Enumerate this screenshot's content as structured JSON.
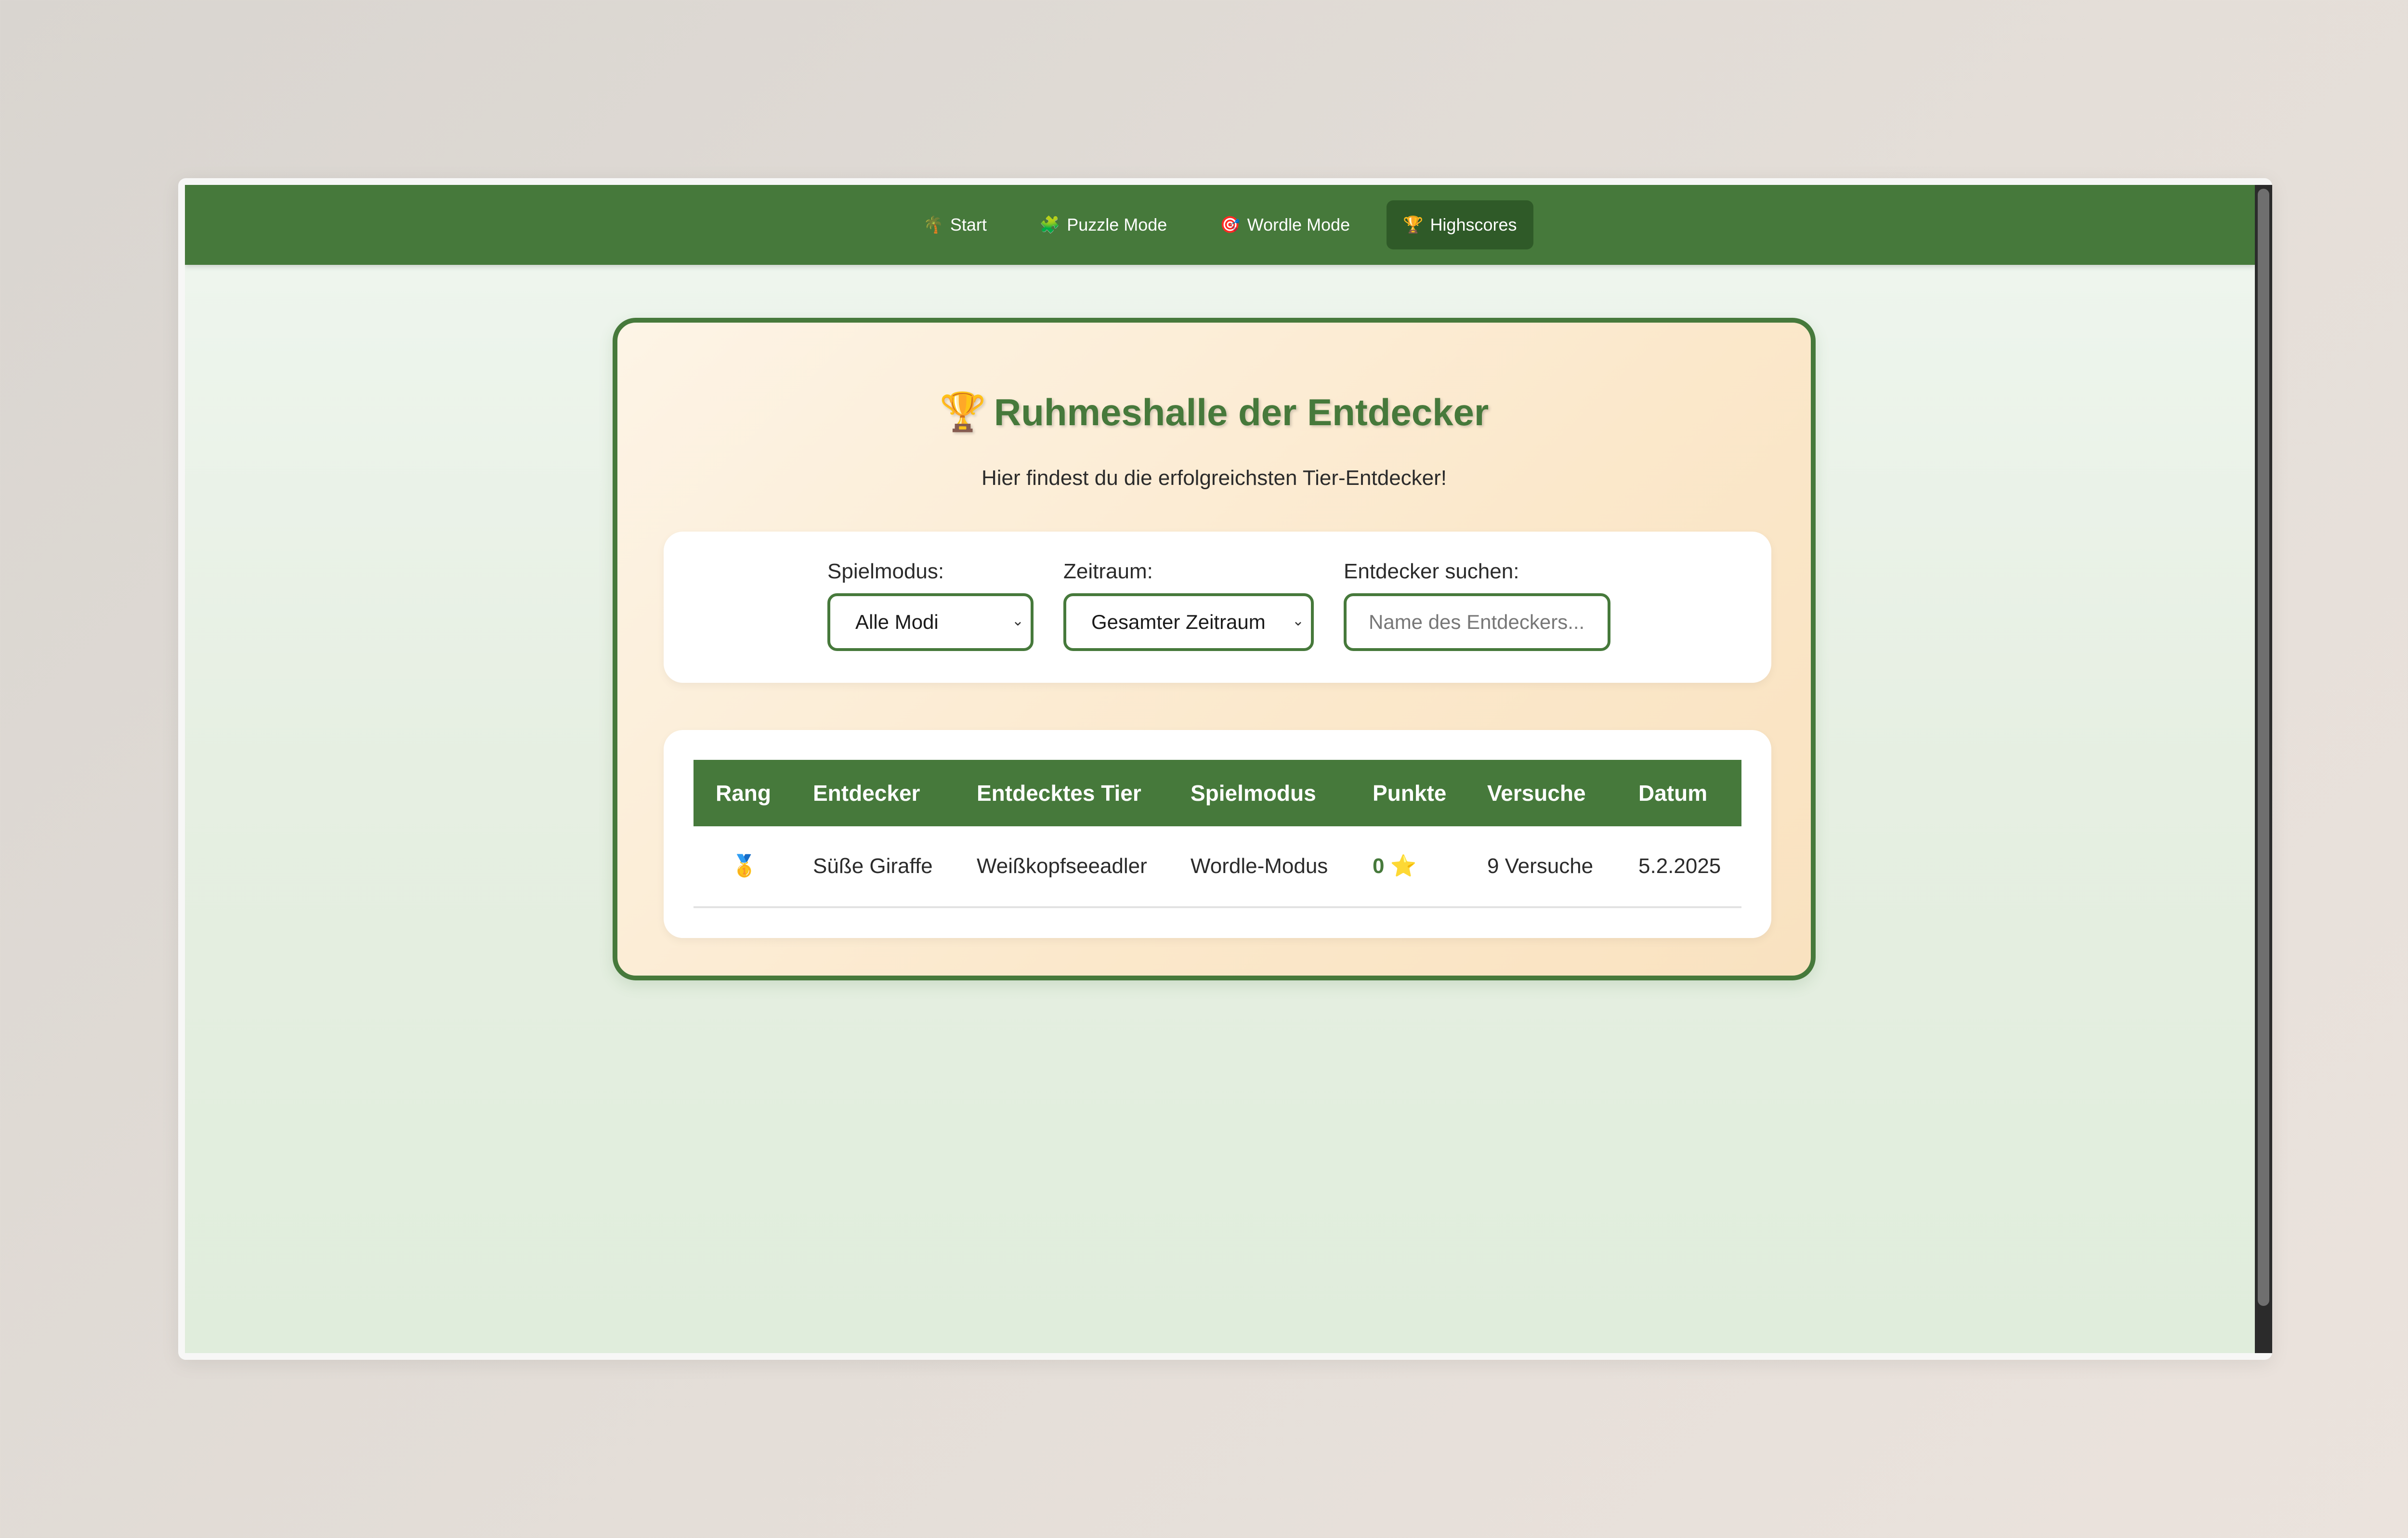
{
  "nav": {
    "items": [
      {
        "icon": "🌴",
        "label": "Start",
        "active": false
      },
      {
        "icon": "🧩",
        "label": "Puzzle Mode",
        "active": false
      },
      {
        "icon": "🎯",
        "label": "Wordle Mode",
        "active": false
      },
      {
        "icon": "🏆",
        "label": "Highscores",
        "active": true
      }
    ]
  },
  "page": {
    "title_icon": "🏆",
    "title": "Ruhmeshalle der Entdecker",
    "subtitle": "Hier findest du die erfolgreichsten Tier-Entdecker!"
  },
  "filters": {
    "mode_label": "Spielmodus:",
    "mode_value": "Alle Modi",
    "period_label": "Zeitraum:",
    "period_value": "Gesamter Zeitraum",
    "search_label": "Entdecker suchen:",
    "search_placeholder": "Name des Entdeckers..."
  },
  "table": {
    "headers": [
      "Rang",
      "Entdecker",
      "Entdecktes Tier",
      "Spielmodus",
      "Punkte",
      "Versuche",
      "Datum"
    ],
    "rows": [
      {
        "rank_icon": "🥇",
        "explorer": "Süße Giraffe",
        "animal": "Weißkopfseeadler",
        "mode": "Wordle-Modus",
        "points": "0",
        "points_icon": "⭐",
        "attempts": "9 Versuche",
        "date": "5.2.2025"
      }
    ]
  },
  "colors": {
    "primary_green": "#46793b",
    "active_nav": "#2f5a28",
    "card_bg": "#fbe8cb"
  }
}
